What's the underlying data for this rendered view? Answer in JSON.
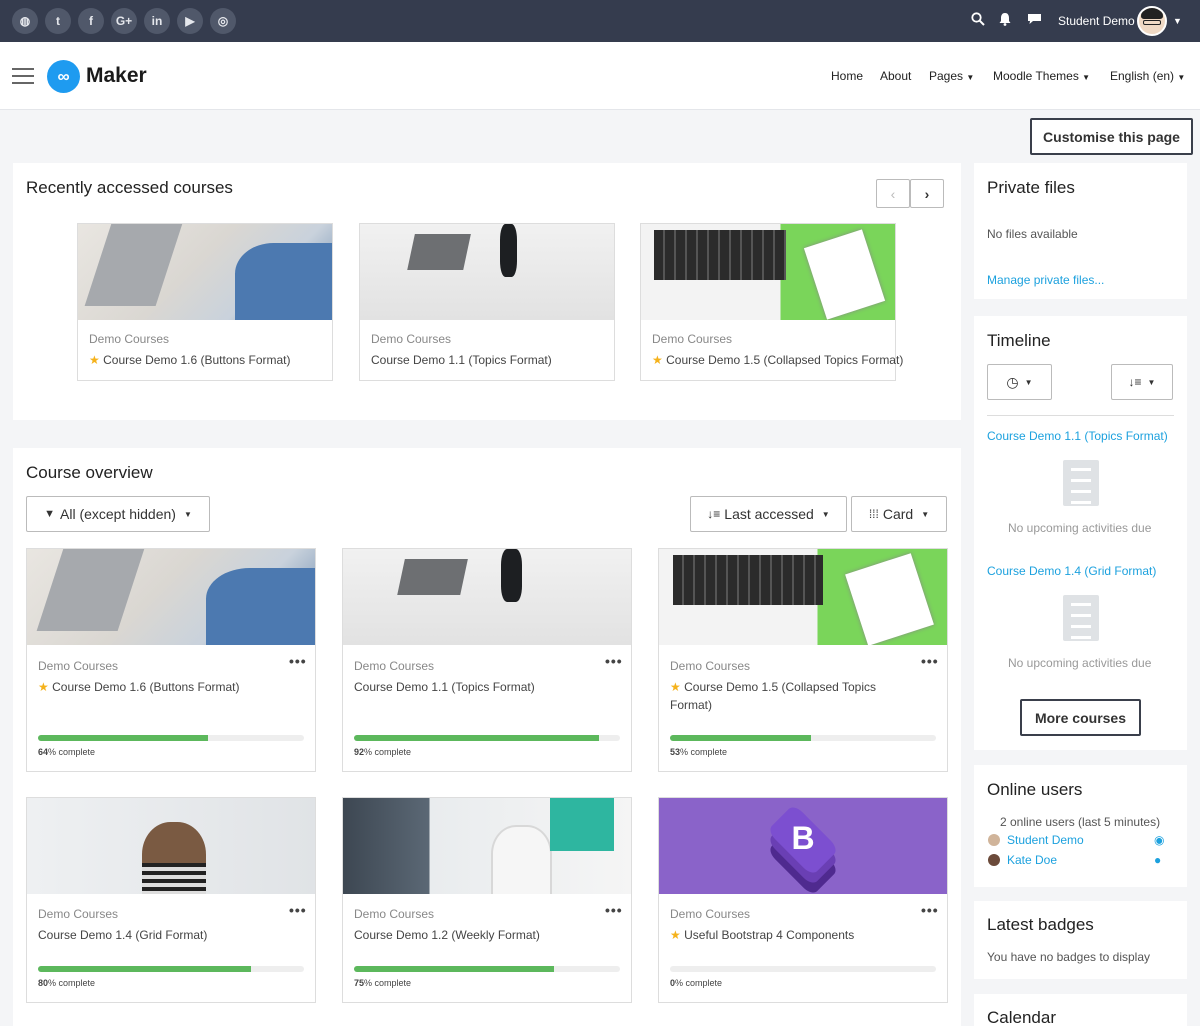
{
  "topbar": {
    "social": [
      {
        "icon": "globe-icon",
        "glyph": "◍"
      },
      {
        "icon": "twitter-icon",
        "glyph": "t"
      },
      {
        "icon": "facebook-icon",
        "glyph": "f"
      },
      {
        "icon": "google-plus-icon",
        "glyph": "G+"
      },
      {
        "icon": "linkedin-icon",
        "glyph": "in"
      },
      {
        "icon": "youtube-icon",
        "glyph": "▶"
      },
      {
        "icon": "instagram-icon",
        "glyph": "◎"
      }
    ],
    "username": "Student Demo"
  },
  "navbar": {
    "logo_text": "Maker",
    "logo_mark": "∞",
    "links": [
      "Home",
      "About",
      "Pages",
      "Moodle Themes",
      "English (en)"
    ]
  },
  "customise_button": "Customise this page",
  "recent": {
    "title": "Recently accessed courses",
    "courses": [
      {
        "category": "Demo Courses",
        "name": "Course Demo 1.6 (Buttons Format)",
        "starred": true
      },
      {
        "category": "Demo Courses",
        "name": "Course Demo 1.1 (Topics Format)",
        "starred": false
      },
      {
        "category": "Demo Courses",
        "name": "Course Demo 1.5 (Collapsed Topics Format)",
        "starred": true
      }
    ]
  },
  "overview": {
    "title": "Course overview",
    "filter_label": "All (except hidden)",
    "sort_label": "Last accessed",
    "view_label": "Card",
    "complete_suffix": "% complete",
    "courses": [
      {
        "category": "Demo Courses",
        "name": "Course Demo 1.6 (Buttons Format)",
        "starred": true,
        "progress": 64,
        "progress_label": "64",
        "name2": ""
      },
      {
        "category": "Demo Courses",
        "name": "Course Demo 1.1 (Topics Format)",
        "starred": false,
        "progress": 92,
        "progress_label": "92",
        "name2": ""
      },
      {
        "category": "Demo Courses",
        "name": "Course Demo 1.5 (Collapsed Topics",
        "name2": "Format)",
        "starred": true,
        "progress": 53,
        "progress_label": "53"
      },
      {
        "category": "Demo Courses",
        "name": "Course Demo 1.4 (Grid Format)",
        "starred": false,
        "progress": 80,
        "progress_label": "80",
        "name2": ""
      },
      {
        "category": "Demo Courses",
        "name": "Course Demo 1.2 (Weekly Format)",
        "starred": false,
        "progress": 75,
        "progress_label": "75",
        "name2": ""
      },
      {
        "category": "Demo Courses",
        "name": "Useful Bootstrap 4 Components",
        "starred": true,
        "progress": 0,
        "progress_label": "0",
        "name2": ""
      }
    ]
  },
  "private_files": {
    "title": "Private files",
    "empty": "No files available",
    "manage": "Manage private files..."
  },
  "timeline": {
    "title": "Timeline",
    "courses": [
      {
        "name": "Course Demo 1.1 (Topics Format)",
        "status": "No upcoming activities due"
      },
      {
        "name": "Course Demo 1.4 (Grid Format)",
        "status": "No upcoming activities due"
      }
    ],
    "more": "More courses"
  },
  "online": {
    "title": "Online users",
    "summary": "2 online users (last 5 minutes)",
    "users": [
      "Student Demo",
      "Kate Doe"
    ]
  },
  "badges": {
    "title": "Latest badges",
    "empty": "You have no badges to display"
  },
  "calendar": {
    "title": "Calendar"
  }
}
